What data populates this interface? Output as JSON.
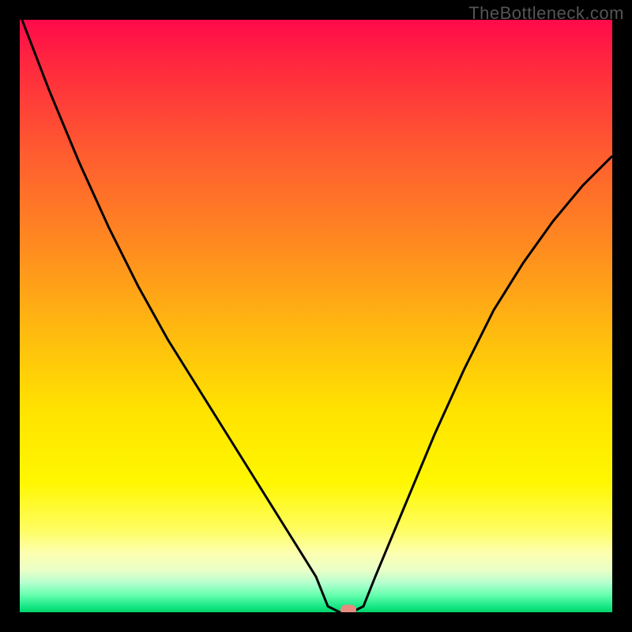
{
  "watermark": "TheBottleneck.com",
  "chart_data": {
    "type": "line",
    "title": "",
    "xlabel": "",
    "ylabel": "",
    "x_range": [
      0,
      1
    ],
    "y_range": [
      0,
      1
    ],
    "series": [
      {
        "name": "curve",
        "x": [
          0.0,
          0.05,
          0.1,
          0.15,
          0.2,
          0.25,
          0.3,
          0.35,
          0.4,
          0.45,
          0.5,
          0.52,
          0.54,
          0.56,
          0.58,
          0.6,
          0.65,
          0.7,
          0.75,
          0.8,
          0.85,
          0.9,
          0.95,
          1.0
        ],
        "y": [
          1.01,
          0.88,
          0.76,
          0.65,
          0.55,
          0.46,
          0.38,
          0.3,
          0.22,
          0.14,
          0.06,
          0.01,
          0.0,
          0.0,
          0.01,
          0.06,
          0.18,
          0.3,
          0.41,
          0.51,
          0.59,
          0.66,
          0.72,
          0.77
        ]
      }
    ],
    "marker": {
      "x": 0.555,
      "y": 0.0
    },
    "colors": {
      "curve": "#000000",
      "marker": "#e78b81",
      "gradient_bands": [
        "#ff0a4a",
        "#ff2a3e",
        "#ff5a30",
        "#ff8a20",
        "#ffb810",
        "#ffe300",
        "#fff700",
        "#fffd60",
        "#fdffb0",
        "#e8ffc8",
        "#b5ffce",
        "#6affb0",
        "#18e885",
        "#00d46a"
      ]
    }
  }
}
